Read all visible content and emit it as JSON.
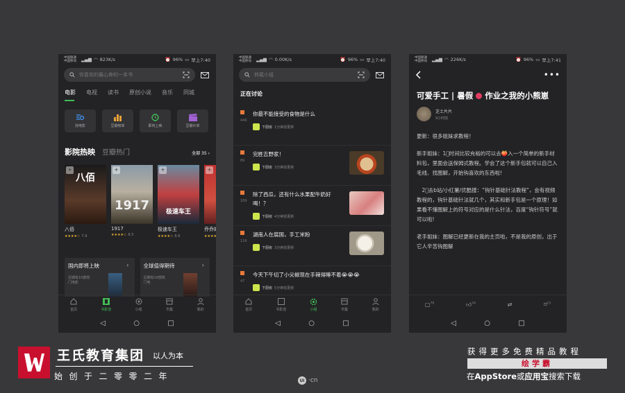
{
  "status": [
    {
      "carrier1": "中国联通",
      "carrier2": "中国移动",
      "speed": "823K/s",
      "battery": "96%",
      "time": "早上7:40"
    },
    {
      "carrier1": "中国联通",
      "carrier2": "中国移动",
      "speed": "0.00K/s",
      "battery": "96%",
      "time": "早上7:40"
    },
    {
      "carrier1": "中国联通",
      "carrier2": "中国移动",
      "speed": "226K/s",
      "battery": "96%",
      "time": "早上7:41"
    }
  ],
  "s1": {
    "search_placeholder": "你喜欢的最心奔的一本书",
    "tabs": [
      "电影",
      "电视",
      "读书",
      "原创小说",
      "音乐",
      "同城"
    ],
    "grid": [
      "找电影",
      "豆瓣榜单",
      "即将上映",
      "豆瓣片单"
    ],
    "section_title": "影院热映",
    "section_alt": "豆瓣热门",
    "all_label": "全部 35",
    "movies": [
      {
        "poster": "八佰",
        "title": "八佰",
        "stars": "★★★★☆",
        "score": "7.9"
      },
      {
        "poster": "1917",
        "title": "1917",
        "stars": "★★★★☆",
        "score": "8.5"
      },
      {
        "poster": "极速车王",
        "title": "极速车王",
        "stars": "★★★★☆",
        "score": "8.6"
      },
      {
        "poster": "乔乔",
        "title": "乔乔的",
        "stars": "★★★★☆",
        "score": ""
      }
    ],
    "lists": [
      {
        "title": "国内即将上映",
        "sub": "近期有10部热门电影"
      },
      {
        "title": "全球值得期待",
        "sub": "近期有10部热门电"
      }
    ],
    "nav": [
      "首页",
      "书影音",
      "小组",
      "市集",
      "我的"
    ]
  },
  "s2": {
    "search_placeholder": "转载小组",
    "heading": "正在讨论",
    "items": [
      {
        "text": "你最不能接受的食物是什么",
        "count": "446",
        "group": "下厨房",
        "time": "1分钟前更新"
      },
      {
        "text": "完胜吉野家！",
        "count": "89",
        "group": "下厨房",
        "time": "3分钟前更新"
      },
      {
        "text": "除了西瓜，还有什么水果配牛奶好喝！？",
        "count": "189",
        "group": "下厨房",
        "time": "4分钟前更新"
      },
      {
        "text": "湖南人在腐国，手工米粉",
        "count": "116",
        "group": "下厨房",
        "time": "3分钟前更新"
      },
      {
        "text": "今天下午切了小尖椒现在手辣得睡不着😭😭😭",
        "count": "47",
        "group": "下厨房",
        "time": "5分钟前更新"
      }
    ],
    "nav": [
      "首页",
      "书影音",
      "小组",
      "市集",
      "我的"
    ]
  },
  "s3": {
    "title": "可爱手工 | 暑假",
    "title2": "作业之我的小熊崽",
    "author": "芝士片片",
    "ago": "9小时前",
    "paras": [
      "更新：很多姐妹求教程！",
      "新手姐妹：1⃣时间比较充裕的可以去🍑入一个简单的新手材料包，里面会送保姆式教程。学会了这个新手包就可以自己入毛线、找图解，开始钩喜欢的东西啦!",
      "　2⃣去b站/小红薯/优酷搜：“钩针基础针法教程”，会有视频教程的，钩针基础针法就几个，其实和新手包是一个原理！如果看不懂图解上的符号对应的是什么针法，百度“钩针符号”就可以啦!",
      "老手姐妹：图解已经更新在我的主页啦，不是我的原创，出于它人辛苦钩图解"
    ],
    "comments": "78",
    "likes": "54",
    "reshares": "",
    "collects": "23"
  },
  "footer": {
    "brand": "王氏教育集团",
    "slogan": "以人为本",
    "since": "始创于二零零二年",
    "uicn": "·cn",
    "r1": "获得更多免费精品教程",
    "r2": "绘学霸",
    "r3a": "在",
    "r3b": "AppStore",
    "r3c": "或",
    "r3d": "应用宝",
    "r3e": "搜索下载"
  },
  "colors": {
    "accent": "#42bd56",
    "star": "#f2b533",
    "brand": "#c8102e"
  }
}
